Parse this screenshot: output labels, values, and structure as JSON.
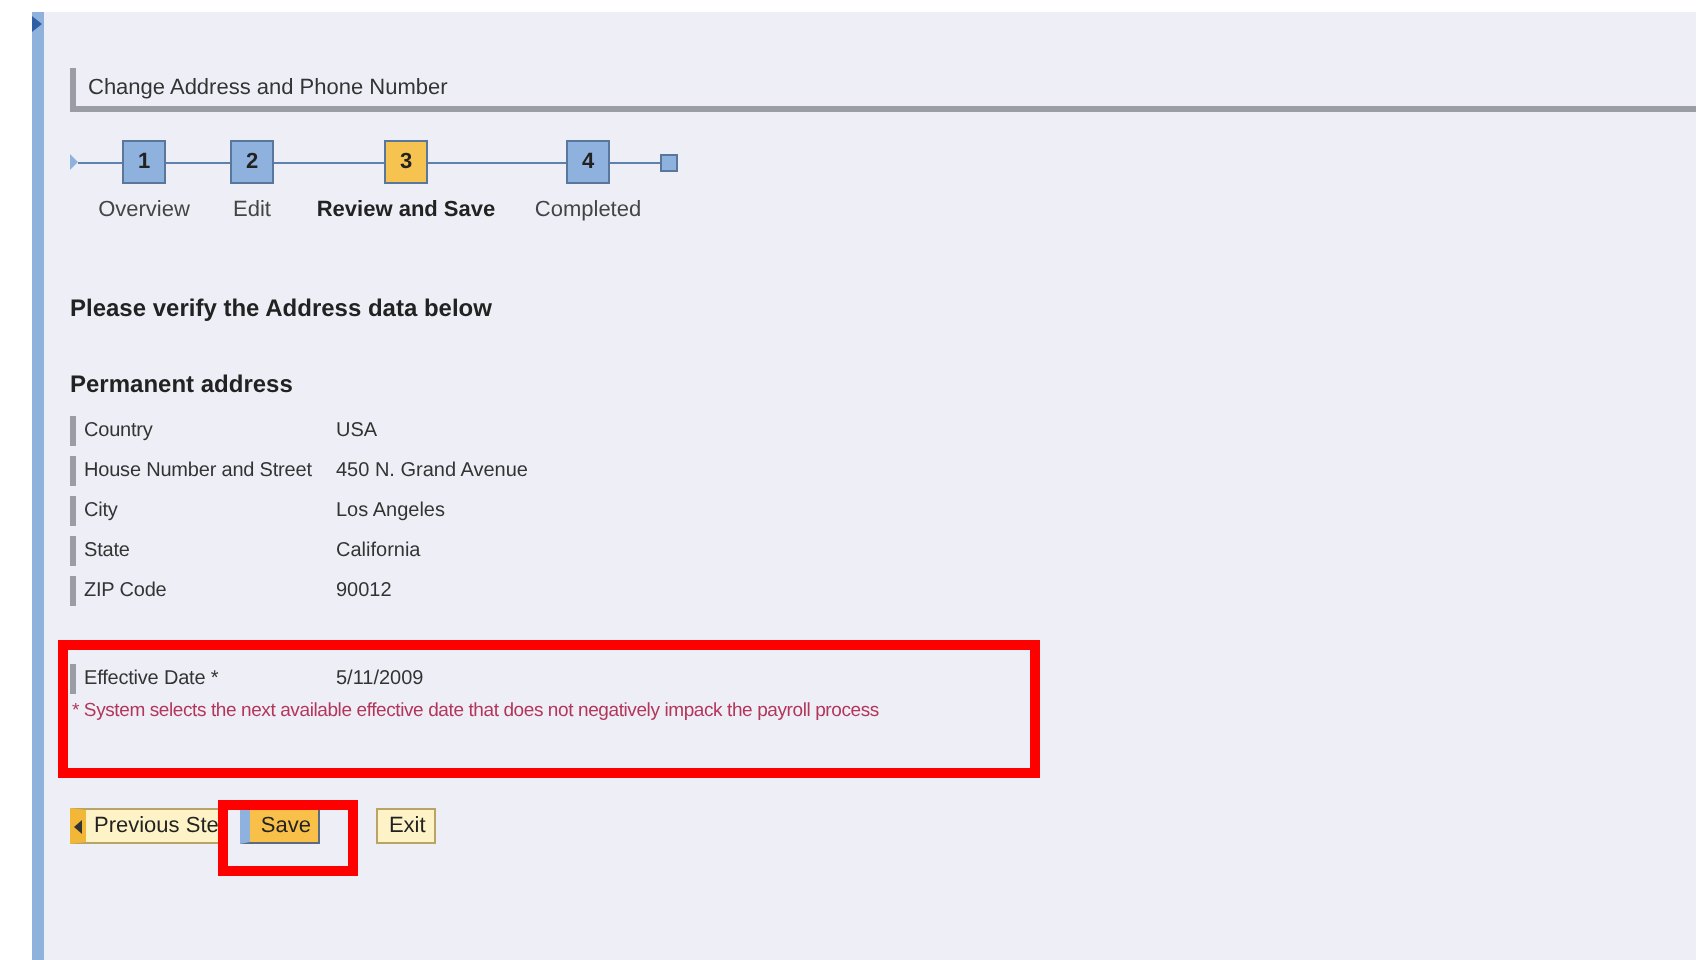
{
  "page": {
    "title": "Change Address and Phone Number"
  },
  "steps": [
    {
      "number": "1",
      "label": "Overview",
      "selected": false
    },
    {
      "number": "2",
      "label": "Edit",
      "selected": false
    },
    {
      "number": "3",
      "label": "Review and Save",
      "selected": true
    },
    {
      "number": "4",
      "label": "Completed",
      "selected": false
    }
  ],
  "heading": "Please verify the Address data below",
  "section": "Permanent address",
  "fields": [
    {
      "label": "Country",
      "value": "USA"
    },
    {
      "label": "House Number and Street",
      "value": "450 N. Grand Avenue"
    },
    {
      "label": "City",
      "value": "Los Angeles"
    },
    {
      "label": "State",
      "value": "California"
    },
    {
      "label": "ZIP Code",
      "value": "90012"
    }
  ],
  "extra_fields": [
    {
      "label": "Effective Date *",
      "value": "5/11/2009"
    }
  ],
  "note": "* System selects the next available effective date that does not negatively impack the payroll process",
  "buttons": [
    {
      "label": "Previous Ste",
      "kind": "back"
    },
    {
      "label": "Save",
      "kind": "primary"
    },
    {
      "label": "Exit",
      "kind": "plain"
    }
  ]
}
